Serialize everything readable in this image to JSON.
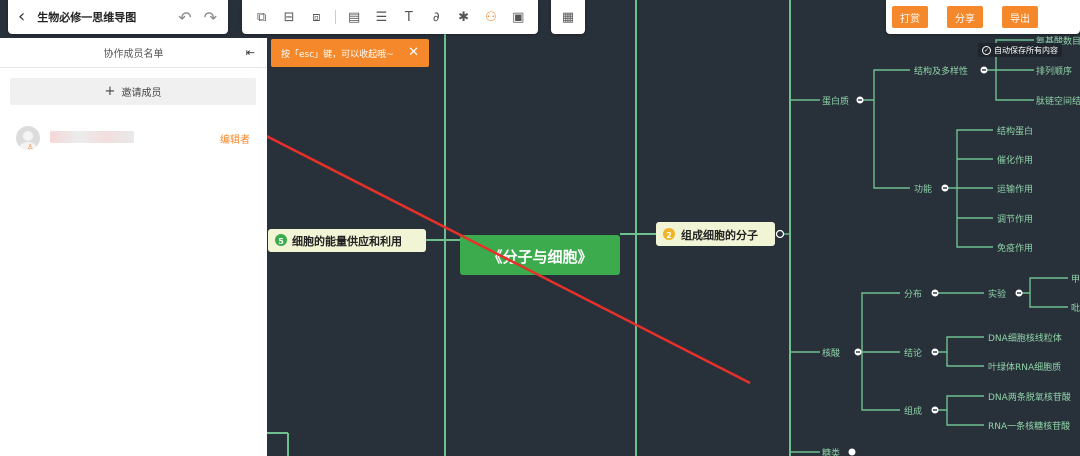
{
  "header": {
    "title": "生物必修一思维导图",
    "undo_icon": "undo-icon",
    "redo_icon": "redo-icon"
  },
  "toolbar": {
    "icons": [
      "subtopic-icon",
      "sibling-topic-icon",
      "parent-topic-icon",
      "format-painter-icon",
      "list-icon",
      "text-icon",
      "attachment-icon",
      "magic-icon",
      "collaborators-icon",
      "save-icon"
    ],
    "qr_icon": "qrcode-icon"
  },
  "actions": {
    "tip_label": "打赏",
    "share_label": "分享",
    "export_label": "导出",
    "autosave": "自动保存所有内容"
  },
  "panel": {
    "title": "协作成员名单",
    "invite_label": "邀请成员",
    "members": [
      {
        "role": "编辑者"
      }
    ]
  },
  "esc_tip": "按「esc」键，可以收起哦~",
  "accent_color": "#f5882a",
  "mindmap": {
    "root": "《分子与细胞》",
    "left_branch": {
      "number": "5",
      "label": "细胞的能量供应和利用"
    },
    "right_branch": {
      "number": "2",
      "label": "组成细胞的分子"
    },
    "protein": {
      "label": "蛋白质",
      "structure": {
        "label": "结构及多样性",
        "children": [
          "氨基酸数目",
          "排列顺序",
          "肽链空间结构"
        ]
      },
      "function": {
        "label": "功能",
        "children": [
          "结构蛋白",
          "催化作用",
          "运输作用",
          "调节作用",
          "免疫作用"
        ]
      }
    },
    "nucleic": {
      "label": "核酸",
      "distribution": {
        "label": "分布",
        "experiment": {
          "label": "实验",
          "children": [
            "甲基绿",
            "吡罗红"
          ]
        }
      },
      "conclusion": {
        "label": "结论",
        "children": [
          "DNA细胞核线粒体",
          "叶绿体RNA细胞质"
        ]
      },
      "composition": {
        "label": "组成",
        "children": [
          "DNA两条脱氧核苷酸",
          "RNA一条核糖核苷酸"
        ]
      }
    },
    "sugar": {
      "label": "糖类"
    }
  }
}
